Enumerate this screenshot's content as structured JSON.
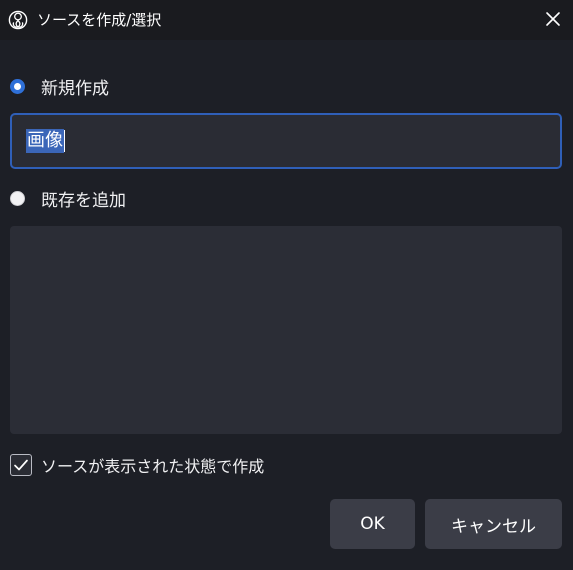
{
  "window": {
    "title": "ソースを作成/選択",
    "app_icon": "obs-icon",
    "close_icon": "close-icon"
  },
  "options": {
    "create_new": {
      "label": "新規作成",
      "checked": true
    },
    "add_existing": {
      "label": "既存を追加",
      "checked": false
    }
  },
  "name_input": {
    "value": "画像",
    "selected": true
  },
  "existing_list": {
    "items": []
  },
  "visible_checkbox": {
    "label": "ソースが表示された状態で作成",
    "checked": true
  },
  "buttons": {
    "ok": "OK",
    "cancel": "キャンセル"
  },
  "colors": {
    "background": "#1d1f26",
    "titlebar": "#1a1b1f",
    "accent": "#2f70d8",
    "input_border": "#2f5fb8",
    "button": "#3b3d47",
    "list_bg": "#2b2d36"
  }
}
